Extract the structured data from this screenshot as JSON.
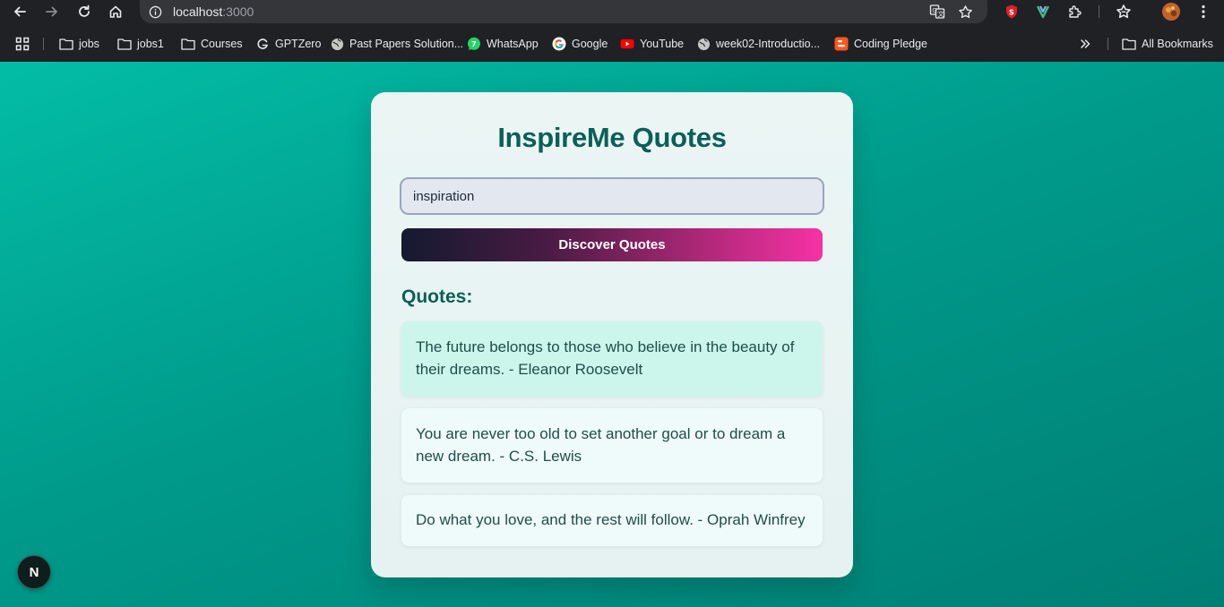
{
  "browser": {
    "url_host": "localhost",
    "url_port": ":3000",
    "bookmarks": [
      {
        "label": "jobs",
        "icon": "folder-icon"
      },
      {
        "label": "jobs1",
        "icon": "folder-icon"
      },
      {
        "label": "Courses",
        "icon": "folder-icon"
      },
      {
        "label": "GPTZero",
        "icon": "gptzero-icon"
      },
      {
        "label": "Past Papers Solution...",
        "icon": "globe-icon"
      },
      {
        "label": "WhatsApp",
        "icon": "whatsapp-icon"
      },
      {
        "label": "Google",
        "icon": "google-icon"
      },
      {
        "label": "YouTube",
        "icon": "youtube-icon"
      },
      {
        "label": "week02-Introductio...",
        "icon": "globe-icon"
      },
      {
        "label": "Coding Pledge",
        "icon": "blogger-icon"
      }
    ],
    "all_bookmarks_label": "All Bookmarks"
  },
  "app": {
    "title": "InspireMe Quotes",
    "search_value": "inspiration",
    "button_label": "Discover Quotes",
    "quotes_heading": "Quotes:",
    "quotes": [
      "The future belongs to those who believe in the beauty of their dreams. - Eleanor Roosevelt",
      "You are never too old to set another goal or to dream a new dream. - C.S. Lewis",
      "Do what you love, and the rest will follow. - Oprah Winfrey"
    ]
  },
  "dev_badge": {
    "label": "N"
  },
  "colors": {
    "page_gradient_start": "#03bda6",
    "page_gradient_end": "#007e74",
    "title_color": "#0b5f57",
    "button_gradient_start": "#141a30",
    "button_gradient_end": "#f632a5",
    "highlight_quote_bg": "#ccf6ec"
  }
}
